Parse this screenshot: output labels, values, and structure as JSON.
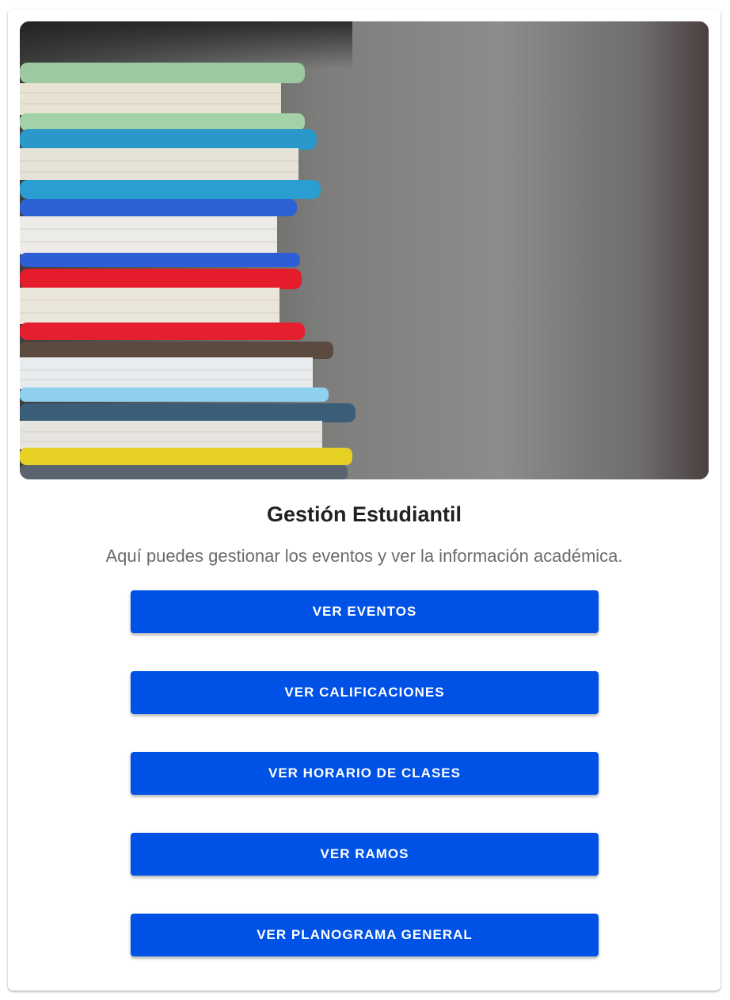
{
  "card": {
    "title": "Gestión Estudiantil",
    "subtitle": "Aquí puedes gestionar los eventos y ver la información académica."
  },
  "actions": [
    {
      "label": "VER EVENTOS"
    },
    {
      "label": "VER CALIFICACIONES"
    },
    {
      "label": "VER HORARIO DE CLASES"
    },
    {
      "label": "VER RAMOS"
    },
    {
      "label": "VER PLANOGRAMA GENERAL"
    }
  ],
  "colors": {
    "button": "#0052e6",
    "button_text": "#ffffff",
    "title": "#212121",
    "subtitle": "#6b6b6b"
  }
}
